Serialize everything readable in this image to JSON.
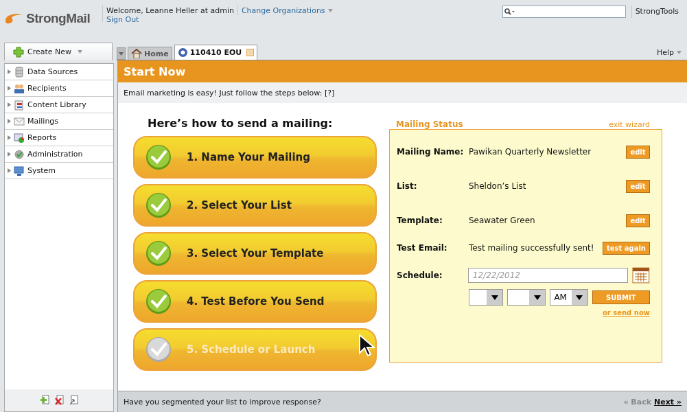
{
  "header": {
    "logo": "StrongMail",
    "welcome": "Welcome, Leanne Heller at admin",
    "sign_out": "Sign Out",
    "change_org": "Change Organizations",
    "tools": "StrongTools"
  },
  "create_new": "Create New",
  "tabs": [
    {
      "label": "Home",
      "selected": false,
      "closable": false
    },
    {
      "label": "110410 EOU",
      "selected": true,
      "closable": true
    }
  ],
  "help": "Help",
  "sidebar": {
    "items": [
      {
        "label": "Data Sources"
      },
      {
        "label": "Recipients"
      },
      {
        "label": "Content Library"
      },
      {
        "label": "Mailings"
      },
      {
        "label": "Reports"
      },
      {
        "label": "Administration"
      },
      {
        "label": "System"
      }
    ]
  },
  "page": {
    "title": "Start Now",
    "intro": "Email marketing is easy! Just follow the steps below: [?]",
    "steps_heading": "Here’s how to send a mailing:"
  },
  "steps": [
    {
      "label": "1. Name Your Mailing",
      "done": true
    },
    {
      "label": "2. Select Your List",
      "done": true
    },
    {
      "label": "3. Select Your Template",
      "done": true
    },
    {
      "label": "4. Test Before You Send",
      "done": true
    },
    {
      "label": "5. Schedule or Launch",
      "done": false
    }
  ],
  "status": {
    "title": "Mailing Status",
    "exit": "exit wizard",
    "rows": [
      {
        "label": "Mailing Name:",
        "value": "Pawikan Quarterly Newsletter",
        "button": "edit"
      },
      {
        "label": "List:",
        "value": "Sheldon’s List",
        "button": "edit"
      },
      {
        "label": "Template:",
        "value": "Seawater Green",
        "button": "edit"
      },
      {
        "label": "Test Email:",
        "value": "Test mailing successfully sent!",
        "button": "test again"
      }
    ],
    "schedule": {
      "label": "Schedule:",
      "date_placeholder": "12/22/2012",
      "ampm": "AM",
      "submit": "SUBMIT",
      "send_now": "or send now"
    }
  },
  "footer": {
    "tip": "Have you segmented your list to improve response?",
    "back": "« Back",
    "next": "Next »"
  }
}
